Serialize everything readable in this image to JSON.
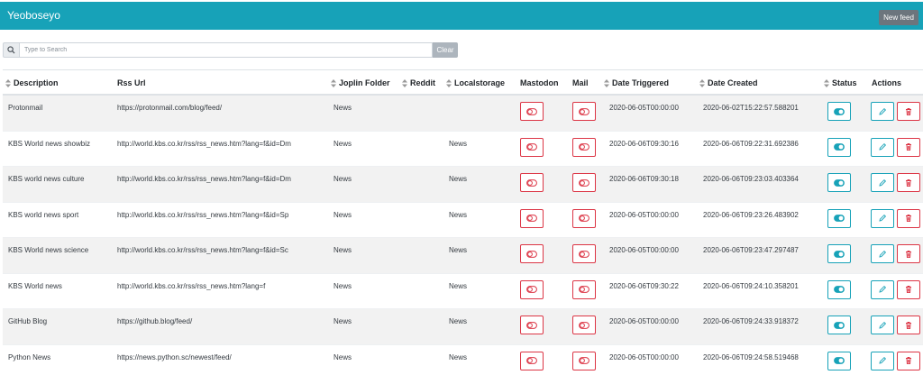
{
  "app": {
    "title": "Yeoboseyo",
    "new_feed_label": "New feed"
  },
  "search": {
    "placeholder": "Type to Search",
    "value": "",
    "clear_label": "Clear"
  },
  "table": {
    "headers": {
      "description": "Description",
      "rss_url": "Rss Url",
      "joplin_folder": "Joplin Folder",
      "reddit": "Reddit",
      "localstorage": "Localstorage",
      "mastodon": "Mastodon",
      "mail": "Mail",
      "date_triggered": "Date Triggered",
      "date_created": "Date Created",
      "status": "Status",
      "actions": "Actions"
    },
    "rows": [
      {
        "description": "Protonmail",
        "rss_url": "https://protonmail.com/blog/feed/",
        "joplin_folder": "News",
        "reddit": "",
        "localstorage": "",
        "date_triggered": "2020-06-05T00:00:00",
        "date_created": "2020-06-02T15:22:57.588201"
      },
      {
        "description": "KBS World news showbiz",
        "rss_url": "http://world.kbs.co.kr/rss/rss_news.htm?lang=f&id=Dm",
        "joplin_folder": "News",
        "reddit": "",
        "localstorage": "News",
        "date_triggered": "2020-06-06T09:30:16",
        "date_created": "2020-06-06T09:22:31.692386"
      },
      {
        "description": "KBS world news culture",
        "rss_url": "http://world.kbs.co.kr/rss/rss_news.htm?lang=f&id=Dm",
        "joplin_folder": "News",
        "reddit": "",
        "localstorage": "News",
        "date_triggered": "2020-06-06T09:30:18",
        "date_created": "2020-06-06T09:23:03.403364"
      },
      {
        "description": "KBS world news sport",
        "rss_url": "http://world.kbs.co.kr/rss/rss_news.htm?lang=f&id=Sp",
        "joplin_folder": "News",
        "reddit": "",
        "localstorage": "News",
        "date_triggered": "2020-06-05T00:00:00",
        "date_created": "2020-06-06T09:23:26.483902"
      },
      {
        "description": "KBS World news science",
        "rss_url": "http://world.kbs.co.kr/rss/rss_news.htm?lang=f&id=Sc",
        "joplin_folder": "News",
        "reddit": "",
        "localstorage": "News",
        "date_triggered": "2020-06-05T00:00:00",
        "date_created": "2020-06-06T09:23:47.297487"
      },
      {
        "description": "KBS World news",
        "rss_url": "http://world.kbs.co.kr/rss/rss_news.htm?lang=f",
        "joplin_folder": "News",
        "reddit": "",
        "localstorage": "News",
        "date_triggered": "2020-06-06T09:30:22",
        "date_created": "2020-06-06T09:24:10.358201"
      },
      {
        "description": "GitHub Blog",
        "rss_url": "https://github.blog/feed/",
        "joplin_folder": "News",
        "reddit": "",
        "localstorage": "News",
        "date_triggered": "2020-06-05T00:00:00",
        "date_created": "2020-06-06T09:24:33.918372"
      },
      {
        "description": "Python News",
        "rss_url": "https://news.python.sc/newest/feed/",
        "joplin_folder": "News",
        "reddit": "",
        "localstorage": "News",
        "date_triggered": "2020-06-05T00:00:00",
        "date_created": "2020-06-06T09:24:58.519468"
      }
    ]
  },
  "icons": {
    "search": "search-icon",
    "sort": "sort-icon",
    "mastodon_toggle": "toggle-off-icon",
    "mail_toggle": "toggle-off-icon",
    "status": "toggle-on-icon",
    "edit": "pencil-icon",
    "delete": "trash-icon"
  },
  "colors": {
    "navbar": "#17a2b8",
    "new_feed_button": "#6c757d",
    "clear_button": "#adb5bd",
    "danger": "#dc3545",
    "info": "#17a2b8",
    "striped_row": "#f2f2f2"
  }
}
